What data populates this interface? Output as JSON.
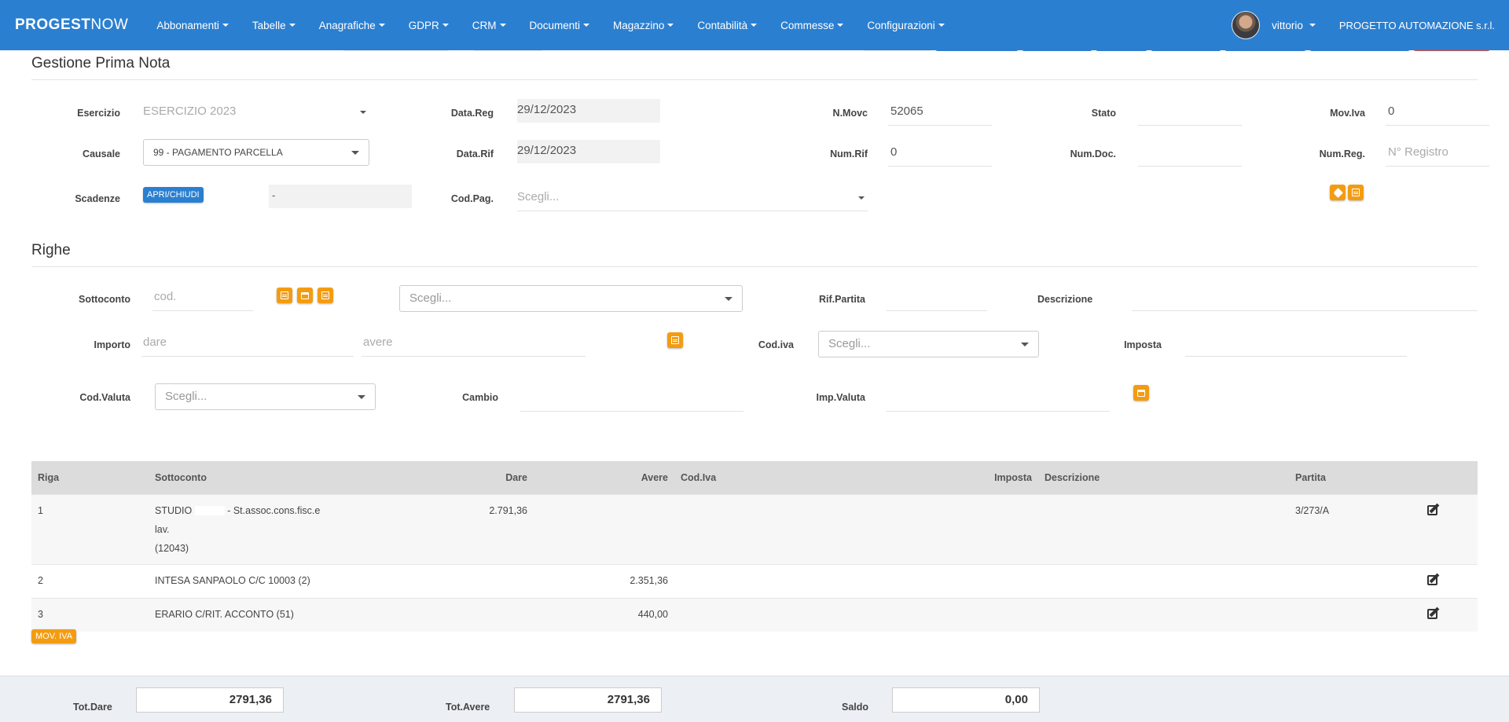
{
  "navbar": {
    "brand_bold": "PROGEST",
    "brand_thin": "NOW",
    "menu": [
      {
        "label": "Abbonamenti"
      },
      {
        "label": "Tabelle"
      },
      {
        "label": "Anagrafiche"
      },
      {
        "label": "GDPR"
      },
      {
        "label": "CRM"
      },
      {
        "label": "Documenti"
      },
      {
        "label": "Magazzino"
      },
      {
        "label": "Contabilità"
      },
      {
        "label": "Commesse"
      },
      {
        "label": "Configurazioni"
      }
    ],
    "user": "vittorio",
    "company": "PROGETTO AUTOMAZIONE s.r.l."
  },
  "header": {
    "title": "Gestione Prima Nota",
    "esercizio_label": "Esercizio",
    "esercizio_value": "ESERCIZIO 2023",
    "causale_label": "Causale",
    "causale_value": "99 - PAGAMENTO PARCELLA",
    "scadenze_label": "Scadenze",
    "scadenze_button": "APRI/CHIUDI",
    "scadenze_value": "-",
    "datareg_label": "Data.Reg",
    "datareg_value": "29/12/2023",
    "datarif_label": "Data.Rif",
    "datarif_value": "29/12/2023",
    "codpag_label": "Cod.Pag.",
    "codpag_placeholder": "Scegli...",
    "nmovc_label": "N.Movc",
    "nmovc_value": "52065",
    "numrif_label": "Num.Rif",
    "numrif_value": "0",
    "stato_label": "Stato",
    "stato_value": "",
    "numdoc_label": "Num.Doc.",
    "numdoc_value": "",
    "moviva_label": "Mov.Iva",
    "moviva_value": "0",
    "numreg_label": "Num.Reg.",
    "numreg_placeholder": "N° Registro"
  },
  "righe": {
    "title": "Righe",
    "sottoconto_label": "Sottoconto",
    "sottoconto_placeholder": "cod.",
    "sottoconto_select": "Scegli...",
    "rifpartita_label": "Rif.Partita",
    "descrizione_label": "Descrizione",
    "importo_label": "Importo",
    "dare_placeholder": "dare",
    "avere_placeholder": "avere",
    "codiva_label": "Cod.iva",
    "codiva_select": "Scegli...",
    "imposta_label": "Imposta",
    "codvaluta_label": "Cod.Valuta",
    "codvaluta_select": "Scegli...",
    "cambio_label": "Cambio",
    "impvaluta_label": "Imp.Valuta"
  },
  "table": {
    "headers": {
      "riga": "Riga",
      "sottoconto": "Sottoconto",
      "dare": "Dare",
      "avere": "Avere",
      "codiva": "Cod.Iva",
      "imposta": "Imposta",
      "descrizione": "Descrizione",
      "partita": "Partita"
    },
    "rows": [
      {
        "riga": "1",
        "sottoconto_a": "STUDIO",
        "sottoconto_b": "- St.assoc.cons.fisc.e lav.",
        "sottoconto_c": "(12043)",
        "dare": "2.791,36",
        "avere": "",
        "codiva": "",
        "imposta": "",
        "descrizione": "",
        "partita": "3/273/A"
      },
      {
        "riga": "2",
        "sottoconto_a": "INTESA SANPAOLO C/C 10003 (2)",
        "dare": "",
        "avere": "2.351,36",
        "codiva": "",
        "imposta": "",
        "descrizione": "",
        "partita": ""
      },
      {
        "riga": "3",
        "sottoconto_a": "ERARIO C/RIT. ACCONTO (51)",
        "dare": "",
        "avere": "440,00",
        "codiva": "",
        "imposta": "",
        "descrizione": "",
        "partita": ""
      }
    ]
  },
  "mov_iva_button": "MOV. IVA",
  "footer": {
    "tot_dare_label": "Tot.Dare",
    "tot_dare_value": "2791,36",
    "tot_avere_label": "Tot.Avere",
    "tot_avere_value": "2791,36",
    "saldo_label": "Saldo",
    "saldo_value": "0,00"
  },
  "colors": {
    "primary": "#2b7fd0",
    "accent": "#f39c12"
  }
}
